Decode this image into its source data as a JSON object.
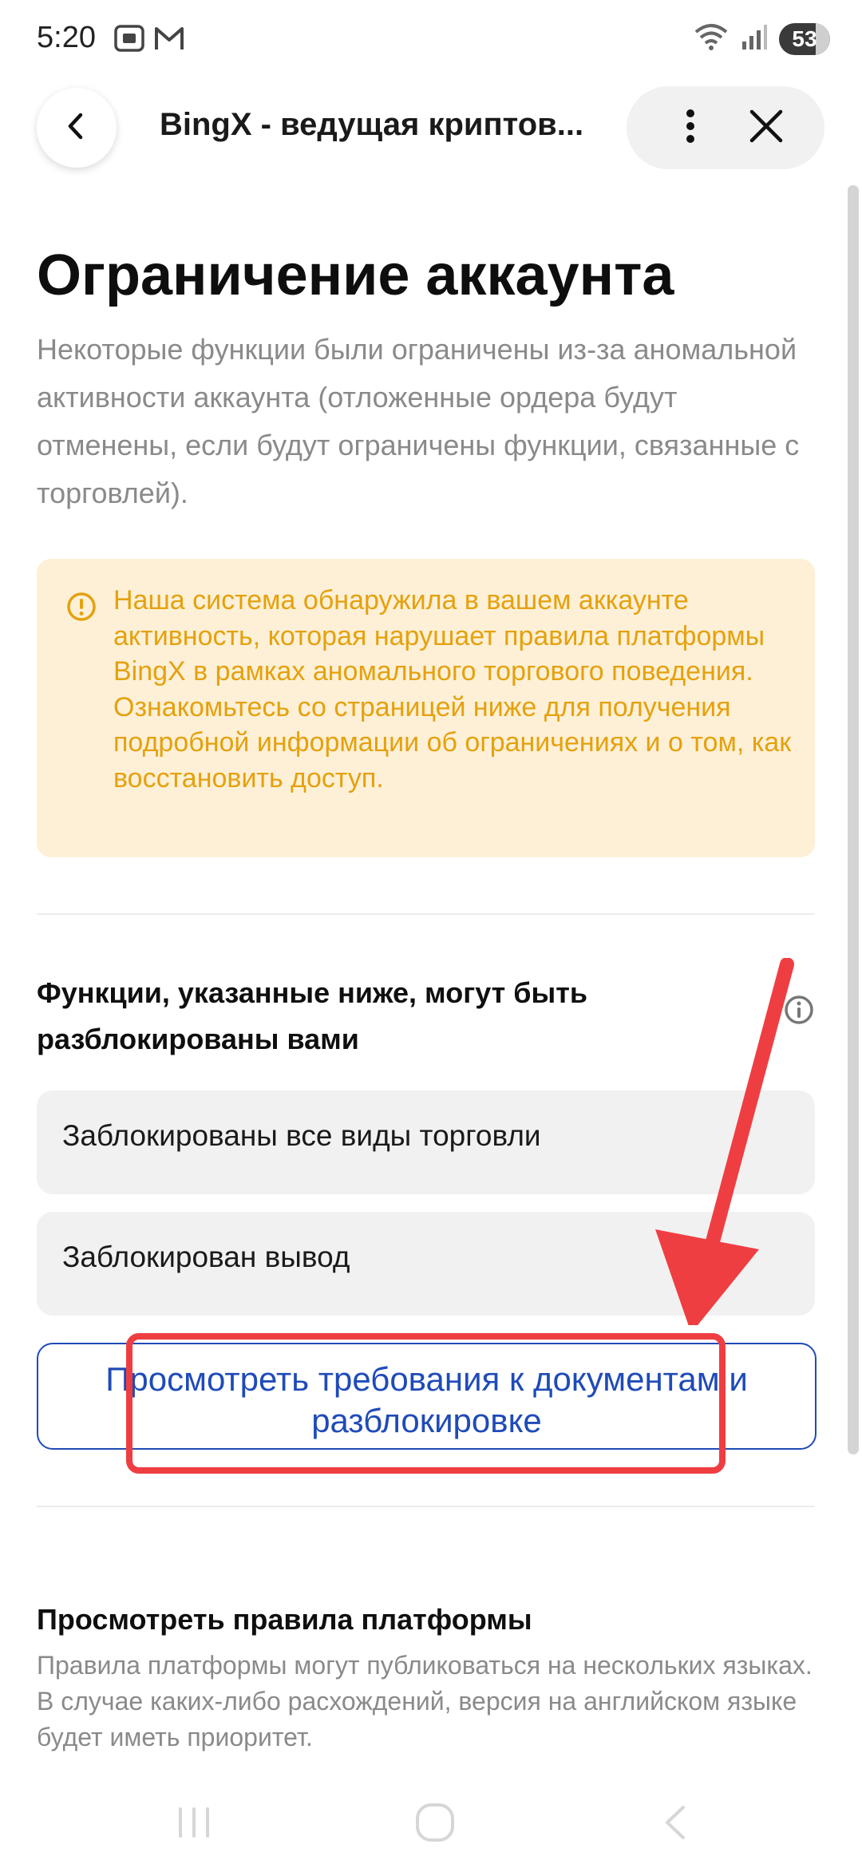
{
  "status_bar": {
    "time": "5:20",
    "battery": "53",
    "network": "5"
  },
  "header": {
    "title": "BingX - ведущая криптов..."
  },
  "page": {
    "title": "Ограничение аккаунта",
    "description": "Некоторые функции были ограничены из-за аномальной активности аккаунта (отложенные ордера будут отменены, если будут ограничены функции, связанные с торговлей)."
  },
  "warning": {
    "text": "Наша система обнаружила в вашем аккаунте активность, которая нарушает правила платформы BingX в рамках аномального торгового поведения. Ознакомьтесь со страницей ниже для получения подробной информации об ограничениях и о том, как восстановить доступ.",
    "color": "#e5a10d",
    "background": "#fdf0d7"
  },
  "unlock_section": {
    "heading": "Функции, указанные ниже, могут быть разблокированы вами",
    "items": [
      "Заблокированы все виды торговли",
      "Заблокирован вывод"
    ],
    "button_label": "Просмотреть требования к документам и разблокировке"
  },
  "rules_section": {
    "heading": "Просмотреть правила платформы",
    "description": "Правила платформы могут публиковаться на нескольких языках. В случае каких-либо расхождений, версия на английском языке будет иметь приоритет."
  },
  "colors": {
    "accent": "#1f4bb8",
    "annotation": "#ef3e42"
  },
  "icons": {
    "back": "chevron-left-icon",
    "more": "more-vertical-icon",
    "close": "close-icon",
    "warning": "warning-circle-icon",
    "info": "info-icon"
  }
}
